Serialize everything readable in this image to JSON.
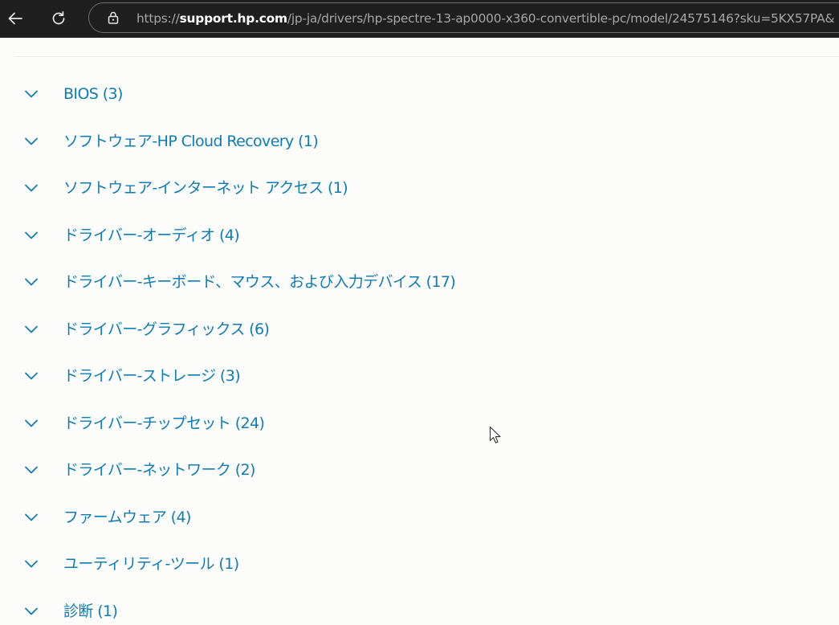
{
  "browser": {
    "url_prefix": "https://",
    "url_domain": "support.hp.com",
    "url_rest": "/jp-ja/drivers/hp-spectre-13-ap0000-x360-convertible-pc/model/24575146?sku=5KX57PA&"
  },
  "categories": [
    {
      "label": "BIOS (3)"
    },
    {
      "label": "ソフトウェア-HP Cloud Recovery (1)"
    },
    {
      "label": "ソフトウェア-インターネット アクセス (1)"
    },
    {
      "label": "ドライバー-オーディオ (4)"
    },
    {
      "label": "ドライバー-キーボード、マウス、および入力デバイス (17)"
    },
    {
      "label": "ドライバー-グラフィックス (6)"
    },
    {
      "label": "ドライバー-ストレージ (3)"
    },
    {
      "label": "ドライバー-チップセット (24)"
    },
    {
      "label": "ドライバー-ネットワーク (2)"
    },
    {
      "label": "ファームウェア (4)"
    },
    {
      "label": "ユーティリティ-ツール (1)"
    },
    {
      "label": "診断 (1)"
    }
  ],
  "colors": {
    "link": "#0f7cb4",
    "browser_bar": "#1f1f1f",
    "page_bg": "#fcfcfa"
  },
  "icons": {
    "back": "back-arrow-icon",
    "reload": "reload-icon",
    "lock": "lock-icon",
    "chevron": "chevron-down-icon",
    "cursor": "mouse-cursor-icon"
  }
}
